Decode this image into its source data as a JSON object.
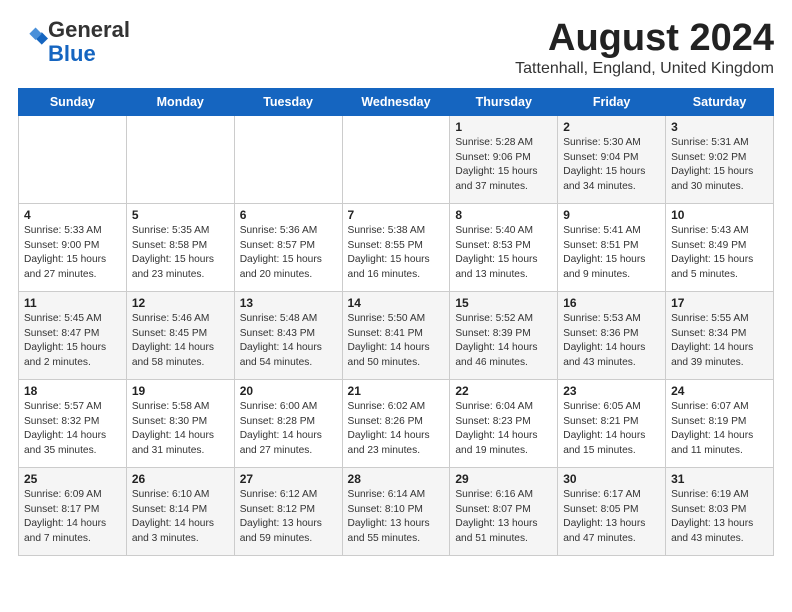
{
  "logo": {
    "general": "General",
    "blue": "Blue"
  },
  "header": {
    "month_year": "August 2024",
    "location": "Tattenhall, England, United Kingdom"
  },
  "days_of_week": [
    "Sunday",
    "Monday",
    "Tuesday",
    "Wednesday",
    "Thursday",
    "Friday",
    "Saturday"
  ],
  "weeks": [
    [
      {
        "day": "",
        "sunrise": "",
        "sunset": "",
        "daylight": ""
      },
      {
        "day": "",
        "sunrise": "",
        "sunset": "",
        "daylight": ""
      },
      {
        "day": "",
        "sunrise": "",
        "sunset": "",
        "daylight": ""
      },
      {
        "day": "",
        "sunrise": "",
        "sunset": "",
        "daylight": ""
      },
      {
        "day": "1",
        "sunrise": "Sunrise: 5:28 AM",
        "sunset": "Sunset: 9:06 PM",
        "daylight": "Daylight: 15 hours and 37 minutes."
      },
      {
        "day": "2",
        "sunrise": "Sunrise: 5:30 AM",
        "sunset": "Sunset: 9:04 PM",
        "daylight": "Daylight: 15 hours and 34 minutes."
      },
      {
        "day": "3",
        "sunrise": "Sunrise: 5:31 AM",
        "sunset": "Sunset: 9:02 PM",
        "daylight": "Daylight: 15 hours and 30 minutes."
      }
    ],
    [
      {
        "day": "4",
        "sunrise": "Sunrise: 5:33 AM",
        "sunset": "Sunset: 9:00 PM",
        "daylight": "Daylight: 15 hours and 27 minutes."
      },
      {
        "day": "5",
        "sunrise": "Sunrise: 5:35 AM",
        "sunset": "Sunset: 8:58 PM",
        "daylight": "Daylight: 15 hours and 23 minutes."
      },
      {
        "day": "6",
        "sunrise": "Sunrise: 5:36 AM",
        "sunset": "Sunset: 8:57 PM",
        "daylight": "Daylight: 15 hours and 20 minutes."
      },
      {
        "day": "7",
        "sunrise": "Sunrise: 5:38 AM",
        "sunset": "Sunset: 8:55 PM",
        "daylight": "Daylight: 15 hours and 16 minutes."
      },
      {
        "day": "8",
        "sunrise": "Sunrise: 5:40 AM",
        "sunset": "Sunset: 8:53 PM",
        "daylight": "Daylight: 15 hours and 13 minutes."
      },
      {
        "day": "9",
        "sunrise": "Sunrise: 5:41 AM",
        "sunset": "Sunset: 8:51 PM",
        "daylight": "Daylight: 15 hours and 9 minutes."
      },
      {
        "day": "10",
        "sunrise": "Sunrise: 5:43 AM",
        "sunset": "Sunset: 8:49 PM",
        "daylight": "Daylight: 15 hours and 5 minutes."
      }
    ],
    [
      {
        "day": "11",
        "sunrise": "Sunrise: 5:45 AM",
        "sunset": "Sunset: 8:47 PM",
        "daylight": "Daylight: 15 hours and 2 minutes."
      },
      {
        "day": "12",
        "sunrise": "Sunrise: 5:46 AM",
        "sunset": "Sunset: 8:45 PM",
        "daylight": "Daylight: 14 hours and 58 minutes."
      },
      {
        "day": "13",
        "sunrise": "Sunrise: 5:48 AM",
        "sunset": "Sunset: 8:43 PM",
        "daylight": "Daylight: 14 hours and 54 minutes."
      },
      {
        "day": "14",
        "sunrise": "Sunrise: 5:50 AM",
        "sunset": "Sunset: 8:41 PM",
        "daylight": "Daylight: 14 hours and 50 minutes."
      },
      {
        "day": "15",
        "sunrise": "Sunrise: 5:52 AM",
        "sunset": "Sunset: 8:39 PM",
        "daylight": "Daylight: 14 hours and 46 minutes."
      },
      {
        "day": "16",
        "sunrise": "Sunrise: 5:53 AM",
        "sunset": "Sunset: 8:36 PM",
        "daylight": "Daylight: 14 hours and 43 minutes."
      },
      {
        "day": "17",
        "sunrise": "Sunrise: 5:55 AM",
        "sunset": "Sunset: 8:34 PM",
        "daylight": "Daylight: 14 hours and 39 minutes."
      }
    ],
    [
      {
        "day": "18",
        "sunrise": "Sunrise: 5:57 AM",
        "sunset": "Sunset: 8:32 PM",
        "daylight": "Daylight: 14 hours and 35 minutes."
      },
      {
        "day": "19",
        "sunrise": "Sunrise: 5:58 AM",
        "sunset": "Sunset: 8:30 PM",
        "daylight": "Daylight: 14 hours and 31 minutes."
      },
      {
        "day": "20",
        "sunrise": "Sunrise: 6:00 AM",
        "sunset": "Sunset: 8:28 PM",
        "daylight": "Daylight: 14 hours and 27 minutes."
      },
      {
        "day": "21",
        "sunrise": "Sunrise: 6:02 AM",
        "sunset": "Sunset: 8:26 PM",
        "daylight": "Daylight: 14 hours and 23 minutes."
      },
      {
        "day": "22",
        "sunrise": "Sunrise: 6:04 AM",
        "sunset": "Sunset: 8:23 PM",
        "daylight": "Daylight: 14 hours and 19 minutes."
      },
      {
        "day": "23",
        "sunrise": "Sunrise: 6:05 AM",
        "sunset": "Sunset: 8:21 PM",
        "daylight": "Daylight: 14 hours and 15 minutes."
      },
      {
        "day": "24",
        "sunrise": "Sunrise: 6:07 AM",
        "sunset": "Sunset: 8:19 PM",
        "daylight": "Daylight: 14 hours and 11 minutes."
      }
    ],
    [
      {
        "day": "25",
        "sunrise": "Sunrise: 6:09 AM",
        "sunset": "Sunset: 8:17 PM",
        "daylight": "Daylight: 14 hours and 7 minutes."
      },
      {
        "day": "26",
        "sunrise": "Sunrise: 6:10 AM",
        "sunset": "Sunset: 8:14 PM",
        "daylight": "Daylight: 14 hours and 3 minutes."
      },
      {
        "day": "27",
        "sunrise": "Sunrise: 6:12 AM",
        "sunset": "Sunset: 8:12 PM",
        "daylight": "Daylight: 13 hours and 59 minutes."
      },
      {
        "day": "28",
        "sunrise": "Sunrise: 6:14 AM",
        "sunset": "Sunset: 8:10 PM",
        "daylight": "Daylight: 13 hours and 55 minutes."
      },
      {
        "day": "29",
        "sunrise": "Sunrise: 6:16 AM",
        "sunset": "Sunset: 8:07 PM",
        "daylight": "Daylight: 13 hours and 51 minutes."
      },
      {
        "day": "30",
        "sunrise": "Sunrise: 6:17 AM",
        "sunset": "Sunset: 8:05 PM",
        "daylight": "Daylight: 13 hours and 47 minutes."
      },
      {
        "day": "31",
        "sunrise": "Sunrise: 6:19 AM",
        "sunset": "Sunset: 8:03 PM",
        "daylight": "Daylight: 13 hours and 43 minutes."
      }
    ]
  ]
}
